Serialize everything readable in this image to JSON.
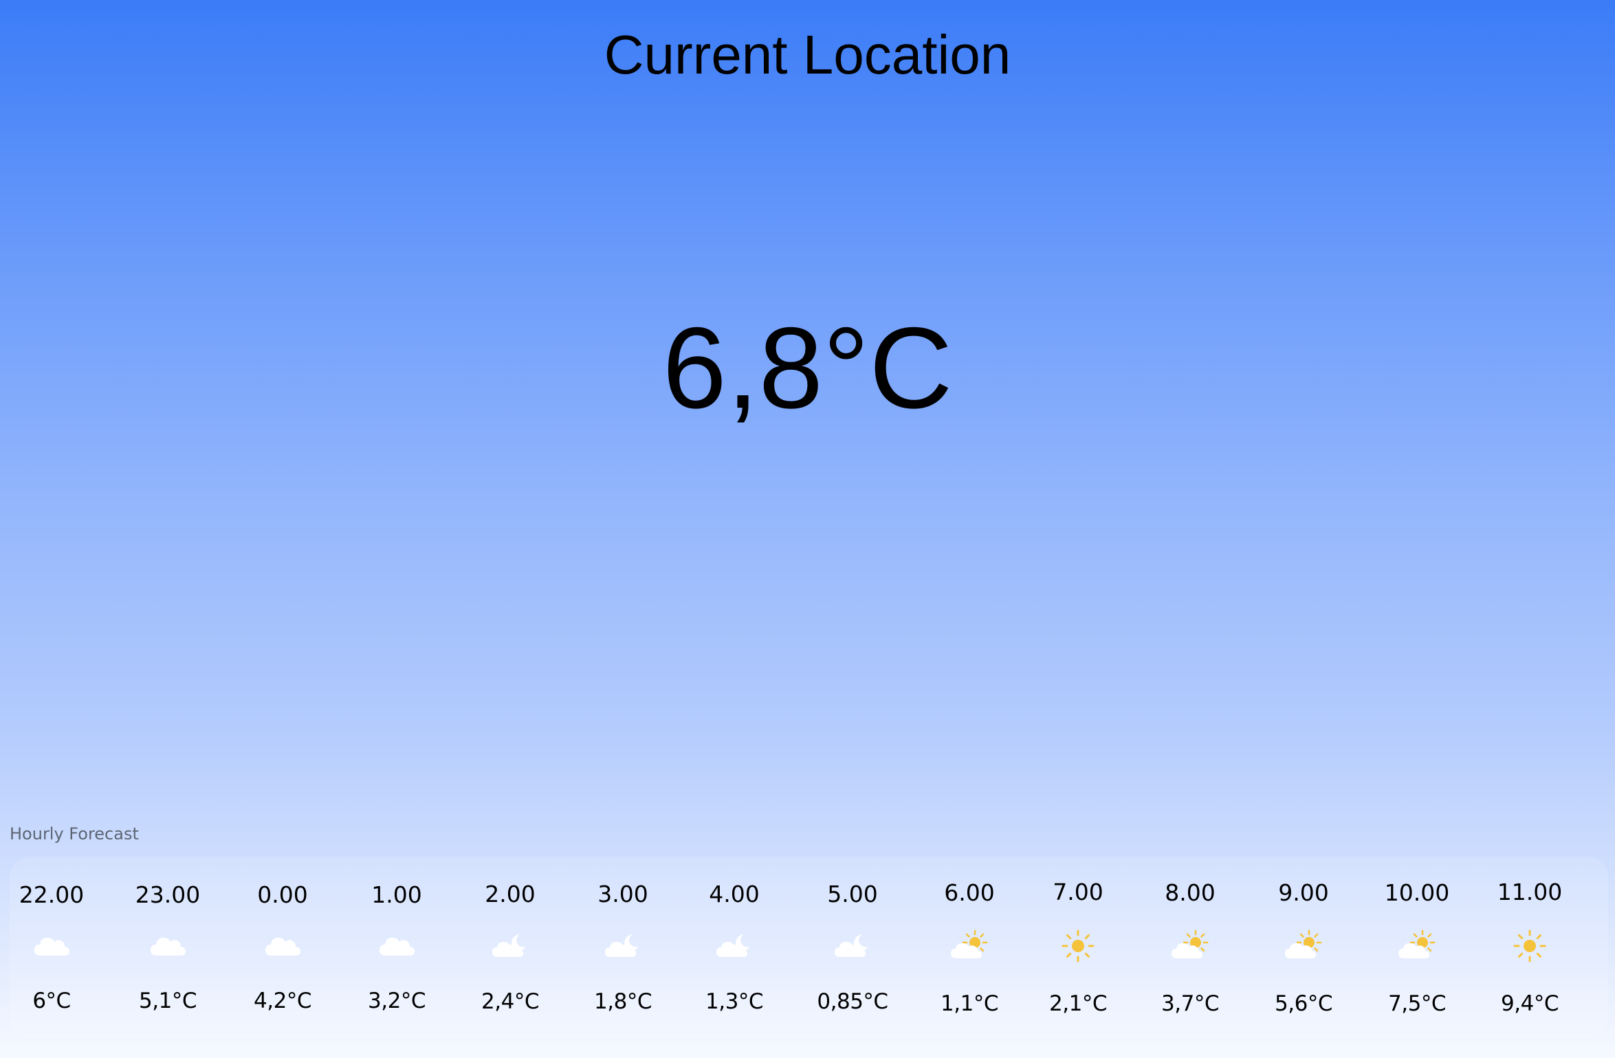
{
  "location": {
    "title": "Current Location"
  },
  "current": {
    "temperature": "6,8°C"
  },
  "forecast": {
    "label": "Hourly Forecast",
    "hours": [
      {
        "time": "22.00",
        "icon": "cloud-icon",
        "temp": "6°C"
      },
      {
        "time": "23.00",
        "icon": "cloud-icon",
        "temp": "5,1°C"
      },
      {
        "time": "0.00",
        "icon": "cloud-icon",
        "temp": "4,2°C"
      },
      {
        "time": "1.00",
        "icon": "cloud-icon",
        "temp": "3,2°C"
      },
      {
        "time": "2.00",
        "icon": "cloud-moon-icon",
        "temp": "2,4°C"
      },
      {
        "time": "3.00",
        "icon": "cloud-moon-icon",
        "temp": "1,8°C"
      },
      {
        "time": "4.00",
        "icon": "cloud-moon-icon",
        "temp": "1,3°C"
      },
      {
        "time": "5.00",
        "icon": "cloud-moon-icon",
        "temp": "0,85°C"
      },
      {
        "time": "6.00",
        "icon": "cloud-sun-icon",
        "temp": "1,1°C"
      },
      {
        "time": "7.00",
        "icon": "sun-icon",
        "temp": "2,1°C"
      },
      {
        "time": "8.00",
        "icon": "cloud-sun-icon",
        "temp": "3,7°C"
      },
      {
        "time": "9.00",
        "icon": "cloud-sun-icon",
        "temp": "5,6°C"
      },
      {
        "time": "10.00",
        "icon": "cloud-sun-icon",
        "temp": "7,5°C"
      },
      {
        "time": "11.00",
        "icon": "sun-icon",
        "temp": "9,4°C"
      }
    ]
  },
  "colors": {
    "gradient_top": "#3b7cf7",
    "gradient_bottom": "#f6f9ff",
    "sun": "#f5c33b",
    "cloud": "#ffffff"
  }
}
